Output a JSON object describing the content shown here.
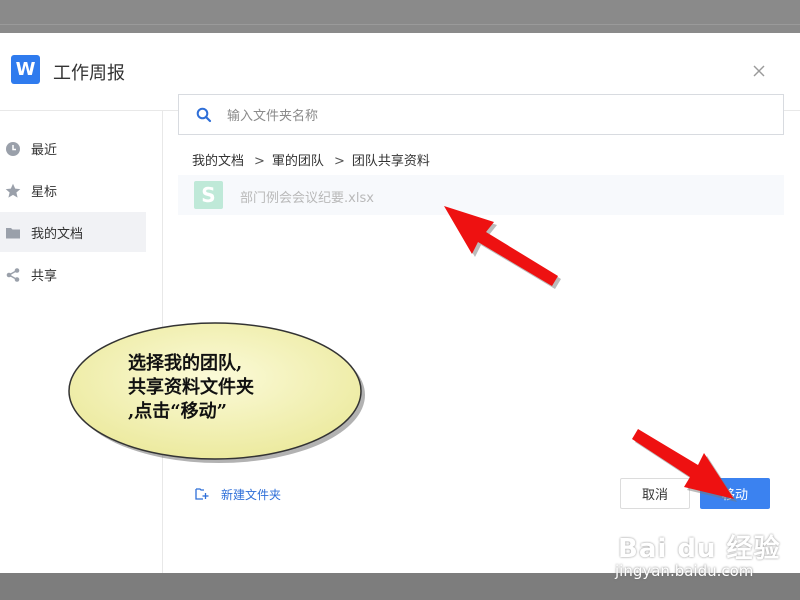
{
  "dialog": {
    "app_logo": "W",
    "title": "工作周报",
    "close_icon": "close-icon"
  },
  "sidebar": {
    "items": [
      {
        "label": "最近",
        "icon": "clock-icon",
        "active": false
      },
      {
        "label": "星标",
        "icon": "star-icon",
        "active": false
      },
      {
        "label": "我的文档",
        "icon": "folder-icon",
        "active": true
      },
      {
        "label": "共享",
        "icon": "share-icon",
        "active": false
      }
    ]
  },
  "search": {
    "placeholder": "输入文件夹名称",
    "value": ""
  },
  "breadcrumb": {
    "items": [
      "我的文档",
      "軍的团队",
      "团队共享资料"
    ],
    "separator": ">"
  },
  "files": [
    {
      "name": "部门例会会议纪要.xlsx",
      "icon_letter": "S",
      "icon": "spreadsheet-icon"
    }
  ],
  "footer": {
    "new_folder_label": "新建文件夹",
    "cancel_label": "取消",
    "move_label": "移动"
  },
  "annotation": {
    "lines": [
      "选择我的团队,",
      "共享资料文件夹",
      ",点击“移动”"
    ]
  },
  "watermark": {
    "brand": "Bai du 经验",
    "url": "jingyan.baidu.com"
  },
  "colors": {
    "accent": "#3b82f0",
    "logo": "#2f7bee",
    "arrow": "#ee1111",
    "bubble": "#f5f3bf"
  }
}
